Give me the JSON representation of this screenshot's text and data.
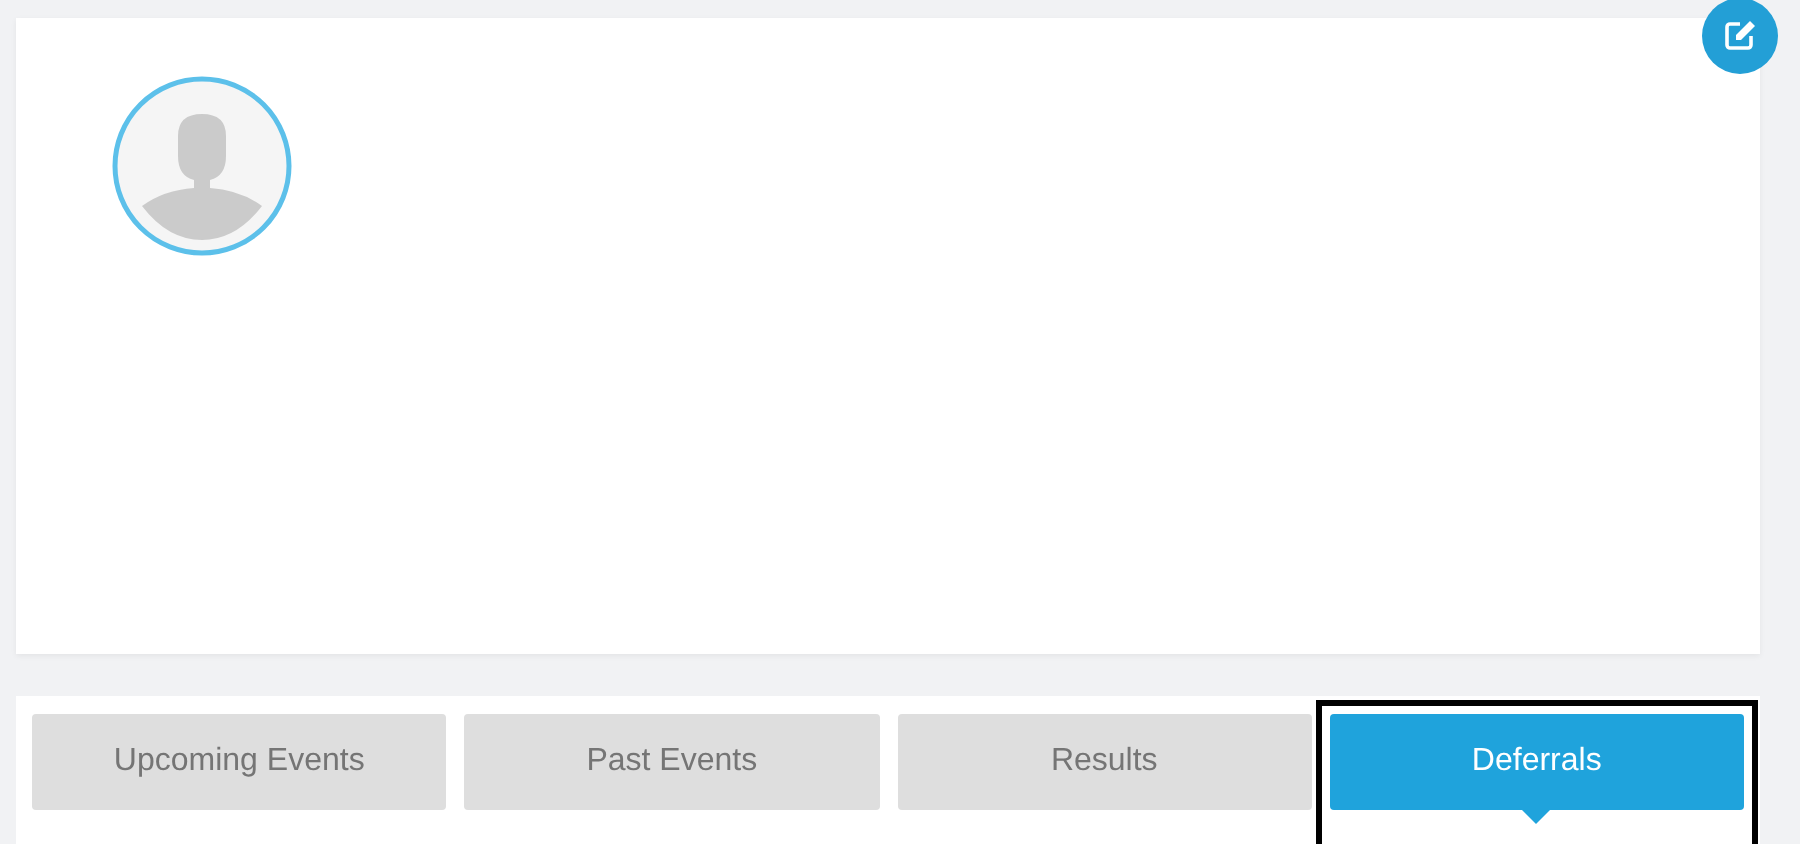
{
  "tabs": [
    {
      "label": "Upcoming Events",
      "selected": false
    },
    {
      "label": "Past Events",
      "selected": false
    },
    {
      "label": "Results",
      "selected": false
    },
    {
      "label": "Deferrals",
      "selected": true
    }
  ]
}
